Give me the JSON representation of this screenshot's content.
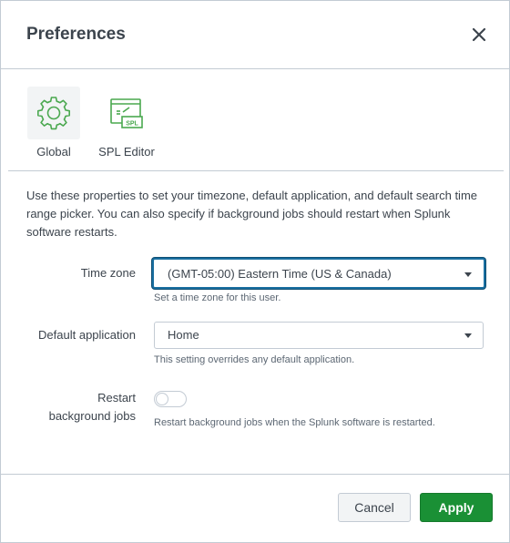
{
  "dialog": {
    "title": "Preferences",
    "close_label": "Close"
  },
  "tabs": [
    {
      "label": "Global",
      "icon": "gear-icon",
      "active": true
    },
    {
      "label": "SPL Editor",
      "icon": "spl-editor-icon",
      "active": false,
      "icon_text": "SPL"
    }
  ],
  "description": "Use these properties to set your timezone, default application, and default search time range picker. You can also specify if background jobs should restart when Splunk software restarts.",
  "fields": {
    "timezone": {
      "label": "Time zone",
      "value": "(GMT-05:00) Eastern Time (US & Canada)",
      "help": "Set a time zone for this user."
    },
    "default_app": {
      "label": "Default application",
      "value": "Home",
      "help": "This setting overrides any default application."
    },
    "restart_jobs": {
      "label_line1": "Restart",
      "label_line2": "background jobs",
      "enabled": false,
      "help": "Restart background jobs when the Splunk software is restarted."
    }
  },
  "footer": {
    "cancel_label": "Cancel",
    "apply_label": "Apply"
  },
  "colors": {
    "accent_green": "#1a9035",
    "icon_green": "#4aa84f",
    "focus_blue": "#1a6fa0",
    "text": "#3c444d",
    "border": "#c3cbd4"
  }
}
